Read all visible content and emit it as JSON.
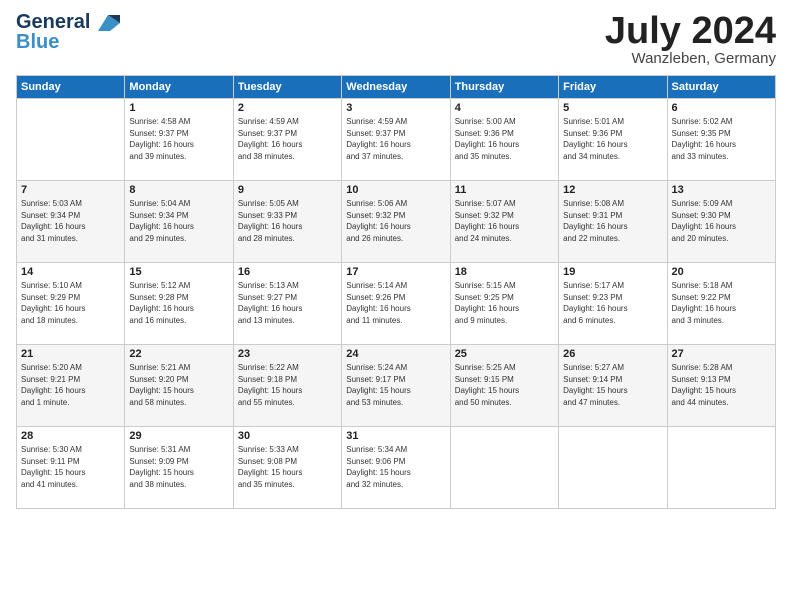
{
  "header": {
    "logo_line1": "General",
    "logo_line2": "Blue",
    "month_title": "July 2024",
    "subtitle": "Wanzleben, Germany"
  },
  "days_of_week": [
    "Sunday",
    "Monday",
    "Tuesday",
    "Wednesday",
    "Thursday",
    "Friday",
    "Saturday"
  ],
  "weeks": [
    [
      {
        "day": "",
        "info": ""
      },
      {
        "day": "1",
        "info": "Sunrise: 4:58 AM\nSunset: 9:37 PM\nDaylight: 16 hours\nand 39 minutes."
      },
      {
        "day": "2",
        "info": "Sunrise: 4:59 AM\nSunset: 9:37 PM\nDaylight: 16 hours\nand 38 minutes."
      },
      {
        "day": "3",
        "info": "Sunrise: 4:59 AM\nSunset: 9:37 PM\nDaylight: 16 hours\nand 37 minutes."
      },
      {
        "day": "4",
        "info": "Sunrise: 5:00 AM\nSunset: 9:36 PM\nDaylight: 16 hours\nand 35 minutes."
      },
      {
        "day": "5",
        "info": "Sunrise: 5:01 AM\nSunset: 9:36 PM\nDaylight: 16 hours\nand 34 minutes."
      },
      {
        "day": "6",
        "info": "Sunrise: 5:02 AM\nSunset: 9:35 PM\nDaylight: 16 hours\nand 33 minutes."
      }
    ],
    [
      {
        "day": "7",
        "info": "Sunrise: 5:03 AM\nSunset: 9:34 PM\nDaylight: 16 hours\nand 31 minutes."
      },
      {
        "day": "8",
        "info": "Sunrise: 5:04 AM\nSunset: 9:34 PM\nDaylight: 16 hours\nand 29 minutes."
      },
      {
        "day": "9",
        "info": "Sunrise: 5:05 AM\nSunset: 9:33 PM\nDaylight: 16 hours\nand 28 minutes."
      },
      {
        "day": "10",
        "info": "Sunrise: 5:06 AM\nSunset: 9:32 PM\nDaylight: 16 hours\nand 26 minutes."
      },
      {
        "day": "11",
        "info": "Sunrise: 5:07 AM\nSunset: 9:32 PM\nDaylight: 16 hours\nand 24 minutes."
      },
      {
        "day": "12",
        "info": "Sunrise: 5:08 AM\nSunset: 9:31 PM\nDaylight: 16 hours\nand 22 minutes."
      },
      {
        "day": "13",
        "info": "Sunrise: 5:09 AM\nSunset: 9:30 PM\nDaylight: 16 hours\nand 20 minutes."
      }
    ],
    [
      {
        "day": "14",
        "info": "Sunrise: 5:10 AM\nSunset: 9:29 PM\nDaylight: 16 hours\nand 18 minutes."
      },
      {
        "day": "15",
        "info": "Sunrise: 5:12 AM\nSunset: 9:28 PM\nDaylight: 16 hours\nand 16 minutes."
      },
      {
        "day": "16",
        "info": "Sunrise: 5:13 AM\nSunset: 9:27 PM\nDaylight: 16 hours\nand 13 minutes."
      },
      {
        "day": "17",
        "info": "Sunrise: 5:14 AM\nSunset: 9:26 PM\nDaylight: 16 hours\nand 11 minutes."
      },
      {
        "day": "18",
        "info": "Sunrise: 5:15 AM\nSunset: 9:25 PM\nDaylight: 16 hours\nand 9 minutes."
      },
      {
        "day": "19",
        "info": "Sunrise: 5:17 AM\nSunset: 9:23 PM\nDaylight: 16 hours\nand 6 minutes."
      },
      {
        "day": "20",
        "info": "Sunrise: 5:18 AM\nSunset: 9:22 PM\nDaylight: 16 hours\nand 3 minutes."
      }
    ],
    [
      {
        "day": "21",
        "info": "Sunrise: 5:20 AM\nSunset: 9:21 PM\nDaylight: 16 hours\nand 1 minute."
      },
      {
        "day": "22",
        "info": "Sunrise: 5:21 AM\nSunset: 9:20 PM\nDaylight: 15 hours\nand 58 minutes."
      },
      {
        "day": "23",
        "info": "Sunrise: 5:22 AM\nSunset: 9:18 PM\nDaylight: 15 hours\nand 55 minutes."
      },
      {
        "day": "24",
        "info": "Sunrise: 5:24 AM\nSunset: 9:17 PM\nDaylight: 15 hours\nand 53 minutes."
      },
      {
        "day": "25",
        "info": "Sunrise: 5:25 AM\nSunset: 9:15 PM\nDaylight: 15 hours\nand 50 minutes."
      },
      {
        "day": "26",
        "info": "Sunrise: 5:27 AM\nSunset: 9:14 PM\nDaylight: 15 hours\nand 47 minutes."
      },
      {
        "day": "27",
        "info": "Sunrise: 5:28 AM\nSunset: 9:13 PM\nDaylight: 15 hours\nand 44 minutes."
      }
    ],
    [
      {
        "day": "28",
        "info": "Sunrise: 5:30 AM\nSunset: 9:11 PM\nDaylight: 15 hours\nand 41 minutes."
      },
      {
        "day": "29",
        "info": "Sunrise: 5:31 AM\nSunset: 9:09 PM\nDaylight: 15 hours\nand 38 minutes."
      },
      {
        "day": "30",
        "info": "Sunrise: 5:33 AM\nSunset: 9:08 PM\nDaylight: 15 hours\nand 35 minutes."
      },
      {
        "day": "31",
        "info": "Sunrise: 5:34 AM\nSunset: 9:06 PM\nDaylight: 15 hours\nand 32 minutes."
      },
      {
        "day": "",
        "info": ""
      },
      {
        "day": "",
        "info": ""
      },
      {
        "day": "",
        "info": ""
      }
    ]
  ]
}
